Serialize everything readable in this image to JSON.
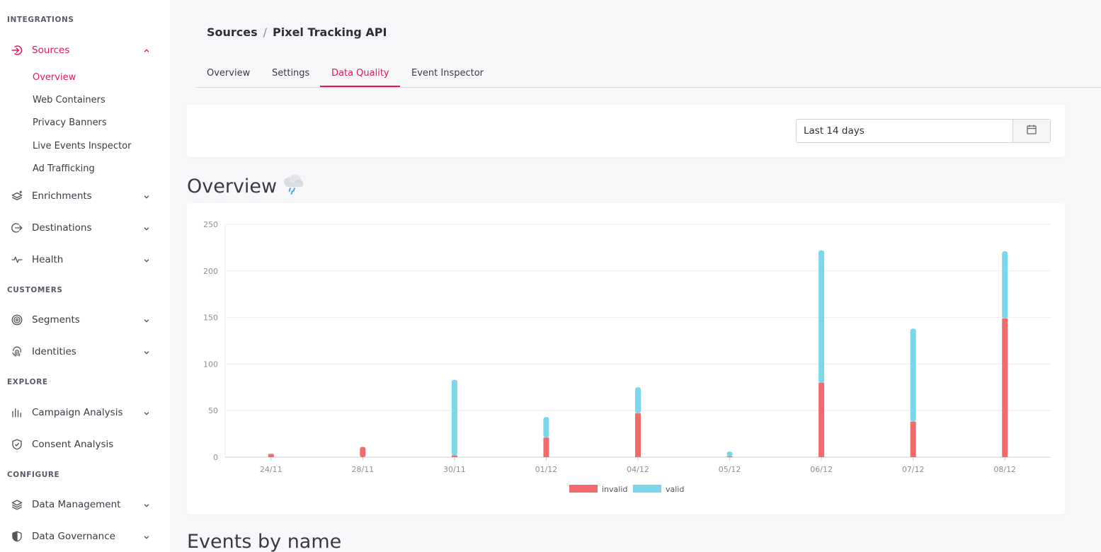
{
  "sidebar": {
    "sections": [
      "INTEGRATIONS",
      "CUSTOMERS",
      "EXPLORE",
      "CONFIGURE"
    ],
    "sources": {
      "label": "Sources",
      "children": [
        "Overview",
        "Web Containers",
        "Privacy Banners",
        "Live Events Inspector",
        "Ad Trafficking"
      ]
    },
    "items": {
      "enrichments": "Enrichments",
      "destinations": "Destinations",
      "health": "Health",
      "segments": "Segments",
      "identities": "Identities",
      "campaign_analysis": "Campaign Analysis",
      "consent_analysis": "Consent Analysis",
      "data_management": "Data Management",
      "data_governance": "Data Governance"
    },
    "active_color": "#e0185c"
  },
  "breadcrumb": {
    "root": "Sources",
    "separator": "/",
    "current": "Pixel Tracking API"
  },
  "tabs": [
    "Overview",
    "Settings",
    "Data Quality",
    "Event Inspector"
  ],
  "active_tab": "Data Quality",
  "date_range": {
    "value": "Last 14 days",
    "icon": "calendar-icon"
  },
  "overview": {
    "title": "Overview",
    "icon": "rain-cloud-icon"
  },
  "events_by_name": {
    "title": "Events by name"
  },
  "chart_data": {
    "type": "bar",
    "stacked": true,
    "categories": [
      "24/11",
      "28/11",
      "30/11",
      "01/12",
      "04/12",
      "05/12",
      "06/12",
      "07/12",
      "08/12"
    ],
    "series": [
      {
        "name": "invalid",
        "color": "#f26b6b",
        "values": [
          3,
          11,
          2,
          21,
          47,
          1,
          80,
          38,
          149
        ]
      },
      {
        "name": "valid",
        "color": "#7ad8e8",
        "values": [
          1,
          0,
          81,
          22,
          28,
          5,
          142,
          100,
          72
        ]
      }
    ],
    "y_ticks": [
      0,
      50,
      100,
      150,
      200,
      250
    ],
    "ylim": [
      0,
      250
    ],
    "grid": true,
    "legend_position": "bottom"
  }
}
